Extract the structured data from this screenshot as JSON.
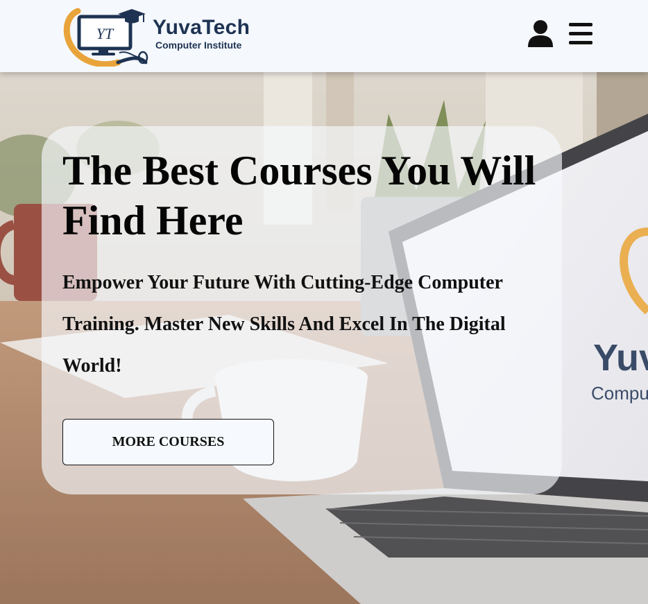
{
  "header": {
    "logo_monogram": "YT",
    "brand_name": "YuvaTech",
    "brand_subtitle": "Computer Institute",
    "user_icon": "user-icon",
    "menu_icon": "hamburger-menu-icon"
  },
  "hero": {
    "title": "The Best Courses You Will Find Here",
    "description": "Empower Your Future With Cutting-Edge Computer Training. Master New Skills And Excel In The Digital World!",
    "cta_label": "MORE COURSES",
    "screen_brand": "Yuv",
    "screen_sub": "Compu"
  },
  "colors": {
    "brand_navy": "#1e3352",
    "brand_orange": "#e8a43a",
    "header_bg": "#f5f9fe",
    "text_dark": "#050505"
  }
}
